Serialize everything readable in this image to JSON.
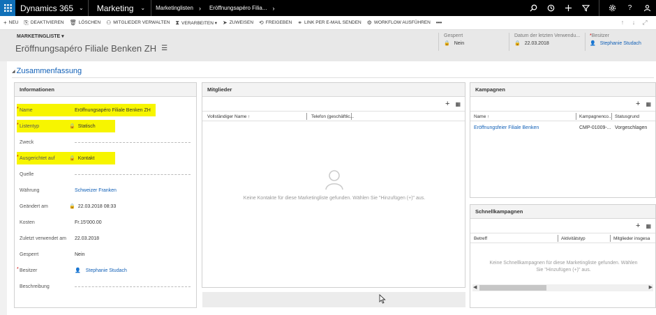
{
  "topnav": {
    "brand": "Dynamics 365",
    "module": "Marketing",
    "breadcrumb": [
      "Marketinglisten",
      "Eröffnungsapéro Filia..."
    ],
    "icons": [
      "search-icon",
      "recent-icon",
      "plus-icon",
      "filter-icon",
      "gear-icon",
      "help-icon",
      "user-icon"
    ]
  },
  "commandbar": {
    "items": [
      {
        "icon": "+",
        "label": "NEU"
      },
      {
        "icon": "⎘",
        "label": "DEAKTIVIEREN"
      },
      {
        "icon": "🗑",
        "label": "LÖSCHEN"
      },
      {
        "icon": "⚇",
        "label": "MITGLIEDER VERWALTEN"
      },
      {
        "icon": "⧗",
        "label": "VERARBEITEN ▾"
      },
      {
        "icon": "➤",
        "label": "ZUWEISEN"
      },
      {
        "icon": "⟲",
        "label": "FREIGEBEN"
      },
      {
        "icon": "⚭",
        "label": "LINK PER E-MAIL SENDEN"
      },
      {
        "icon": "⚙",
        "label": "WORKFLOW AUSFÜHREN"
      },
      {
        "icon": "",
        "label": "•••"
      }
    ],
    "nav": [
      "↑",
      "↓",
      "⤢"
    ]
  },
  "header": {
    "entity_type": "MARKETINGLISTE ▾",
    "title": "Eröffnungsapéro Filiale Benken ZH",
    "fields": [
      {
        "label": "Gesperrt",
        "value": "Nein"
      },
      {
        "label": "Datum der letzten Verwendu...",
        "value": "22.03.2018"
      },
      {
        "label": "Besitzer",
        "value": "Stephanie Studach"
      }
    ]
  },
  "section": {
    "title": "Zusammenfassung"
  },
  "info": {
    "title": "Informationen",
    "fields": [
      {
        "label": "Name",
        "required": "*",
        "value": "Eröffnungsapéro Filiale Benken ZH"
      },
      {
        "label": "Listentyp",
        "required": "*",
        "value": "Statisch"
      },
      {
        "label": "Zweck",
        "required": "",
        "value": ""
      },
      {
        "label": "Ausgerichtet auf",
        "required": "*",
        "value": "Kontakt"
      },
      {
        "label": "Quelle",
        "required": "",
        "value": ""
      },
      {
        "label": "Währung",
        "required": "",
        "value": "Schweizer Franken"
      },
      {
        "label": "Geändert am",
        "required": "",
        "value": "22.03.2018   08:33"
      },
      {
        "label": "Kosten",
        "required": "",
        "value": "Fr.15'000.00"
      },
      {
        "label": "Zuletzt verwendet am",
        "required": "",
        "value": "22.03.2018"
      },
      {
        "label": "Gesperrt",
        "required": "",
        "value": "Nein"
      },
      {
        "label": "Besitzer",
        "required": "*",
        "value": "Stephanie Studach"
      },
      {
        "label": "Beschreibung",
        "required": "",
        "value": ""
      }
    ]
  },
  "members": {
    "title": "Mitglieder",
    "columns": [
      "Vollständiger Name ↑",
      "Telefon (geschäftlic..."
    ],
    "empty": "Keine Kontakte für diese Marketingliste gefunden. Wählen Sie \"Hinzufügen (+)\" aus."
  },
  "campaigns": {
    "title": "Kampagnen",
    "columns": [
      "Name ↑",
      "Kampagnenco...",
      "Statusgrund"
    ],
    "rows": [
      {
        "name": "Eröffnungsfeier Filiale Benken",
        "code": "CMP-01009-...",
        "status": "Vorgeschlagen"
      }
    ]
  },
  "quick": {
    "title": "Schnellkampagnen",
    "columns": [
      "Betreff",
      "Aktivitätstyp",
      "Mitglieder insgesa"
    ],
    "empty_line1": "Keine Schnellkampagnen für diese Marketingliste gefunden. Wählen",
    "empty_line2": "Sie \"Hinzufügen (+)\" aus."
  },
  "colors": {
    "accent": "#1160b7",
    "highlight": "#f7f500",
    "nav": "#000000",
    "waffle": "#1070b8"
  }
}
